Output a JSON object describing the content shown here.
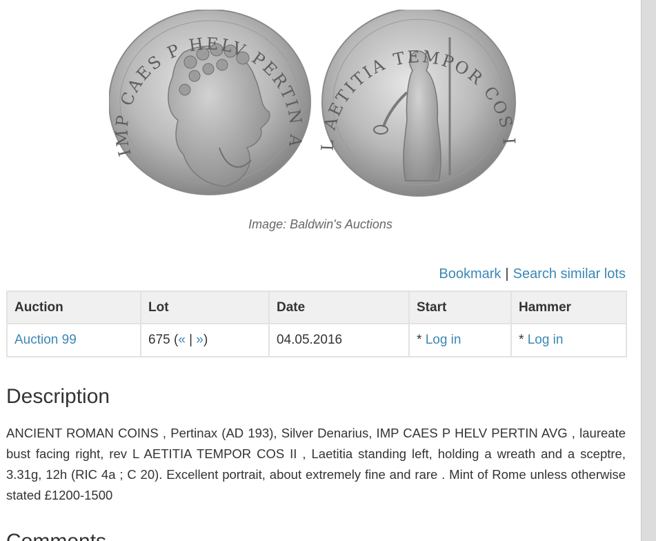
{
  "image": {
    "caption": "Image: Baldwin's Auctions",
    "obverse_legend": "IMP CAES P HELV PERTIN AVG",
    "reverse_legend": "L AETITIA TEMPOR COS II"
  },
  "actions": {
    "bookmark": "Bookmark",
    "separator": "|",
    "search_similar": "Search similar lots"
  },
  "table": {
    "headers": [
      "Auction",
      "Lot",
      "Date",
      "Start",
      "Hammer"
    ],
    "row": {
      "auction": "Auction 99",
      "lot_number": "675",
      "lot_open": " (",
      "prev": "«",
      "nav_sep": " | ",
      "next": "»",
      "lot_close": ")",
      "date": "04.05.2016",
      "start_prefix": "* ",
      "start_link": "Log in",
      "hammer_prefix": "* ",
      "hammer_link": "Log in"
    }
  },
  "description": {
    "heading": "Description",
    "text": "ANCIENT ROMAN COINS , Pertinax (AD 193), Silver Denarius, IMP CAES P HELV PERTIN AVG , laureate bust facing right, rev L AETITIA TEMPOR COS II , Laetitia standing left, holding a wreath and a sceptre, 3.31g, 12h (RIC 4a ; C 20). Excellent portrait, about extremely fine and rare . Mint of Rome unless otherwise stated £1200-1500"
  },
  "comments": {
    "heading": "Comments"
  },
  "colors": {
    "link": "#3a87b5",
    "text": "#333333",
    "header_bg": "#f0f0f0",
    "border": "#e2e2e2",
    "scrollbar": "#dcdcdc"
  }
}
